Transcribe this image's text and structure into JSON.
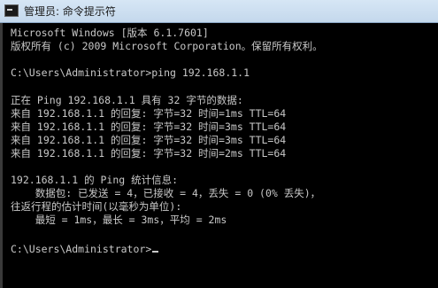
{
  "window": {
    "title": "管理员: 命令提示符"
  },
  "console": {
    "lines": [
      "Microsoft Windows [版本 6.1.7601]",
      "版权所有 (c) 2009 Microsoft Corporation。保留所有权利。",
      "",
      "C:\\Users\\Administrator>ping 192.168.1.1",
      "",
      "正在 Ping 192.168.1.1 具有 32 字节的数据:",
      "来自 192.168.1.1 的回复: 字节=32 时间=1ms TTL=64",
      "来自 192.168.1.1 的回复: 字节=32 时间=3ms TTL=64",
      "来自 192.168.1.1 的回复: 字节=32 时间=3ms TTL=64",
      "来自 192.168.1.1 的回复: 字节=32 时间=2ms TTL=64",
      "",
      "192.168.1.1 的 Ping 统计信息:",
      "    数据包: 已发送 = 4，已接收 = 4，丢失 = 0 (0% 丢失)，",
      "往返行程的估计时间(以毫秒为单位):",
      "    最短 = 1ms，最长 = 3ms，平均 = 2ms",
      "",
      "C:\\Users\\Administrator>"
    ]
  }
}
